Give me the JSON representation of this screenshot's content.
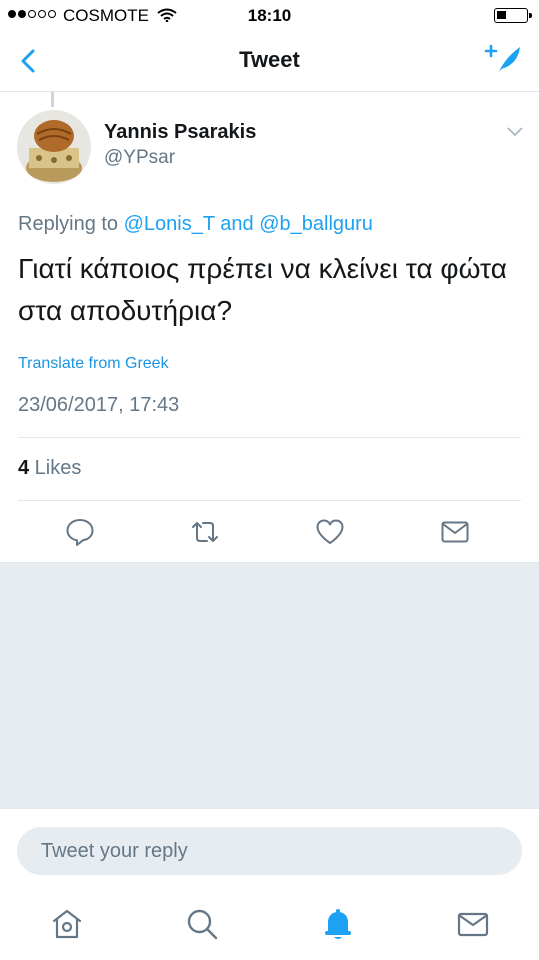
{
  "status_bar": {
    "carrier": "COSMOTE",
    "time": "18:10",
    "signal_bars_filled": 2,
    "signal_bars_total": 5
  },
  "nav": {
    "title": "Tweet",
    "back_icon": "chevron-left-icon",
    "compose_icon": "compose-tweet-icon"
  },
  "tweet": {
    "author_name": "Yannis Psarakis",
    "author_handle": "@YPsar",
    "replying_prefix": "Replying to ",
    "reply_to_1": "@Lonis_T",
    "reply_joiner": " and ",
    "reply_to_2": "@b_ballguru",
    "text": "Γιατί κάποιος πρέπει να κλείνει τα φώτα στα αποδυτήρια?",
    "translate_label": "Translate from Greek",
    "timestamp": "23/06/2017, 17:43",
    "likes_count": "4",
    "likes_label": " Likes"
  },
  "actions": [
    "reply-icon",
    "retweet-icon",
    "like-icon",
    "message-icon"
  ],
  "reply_box": {
    "placeholder": "Tweet your reply"
  },
  "tabbar": [
    "home-icon",
    "search-icon",
    "notifications-icon",
    "messages-icon"
  ],
  "colors": {
    "accent": "#1da1f2",
    "secondary_text": "#657786",
    "background_gray": "#e6ecf0",
    "divider": "#e1e8ed"
  }
}
